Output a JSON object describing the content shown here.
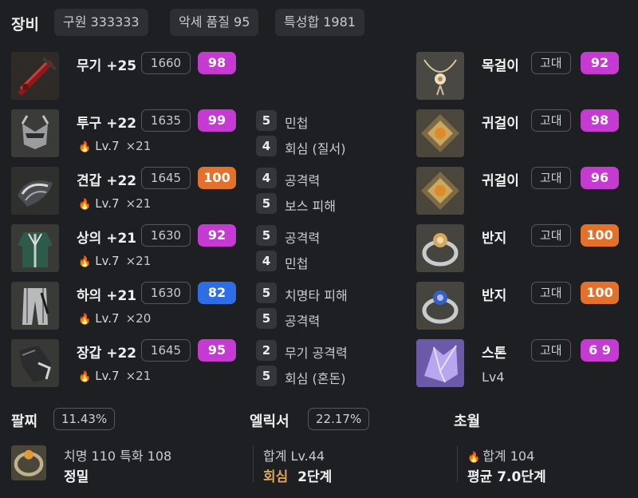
{
  "header": {
    "title": "장비",
    "chips": [
      "구원 333333",
      "악세 품질 95",
      "특성합 1981"
    ]
  },
  "gear": [
    {
      "name": "무기 +25",
      "ilvl": "1660",
      "quality": "98",
      "qcolor": "purple",
      "icon": "weapon-icon",
      "gem": null,
      "stats": []
    },
    {
      "name": "투구 +22",
      "ilvl": "1635",
      "quality": "99",
      "qcolor": "purple",
      "icon": "helmet-icon",
      "gem": {
        "level": "Lv.7",
        "count": "×21"
      },
      "stats": [
        {
          "num": "5",
          "label": "민첩"
        },
        {
          "num": "4",
          "label": "회심 (질서)"
        }
      ]
    },
    {
      "name": "견갑 +22",
      "ilvl": "1645",
      "quality": "100",
      "qcolor": "orange",
      "icon": "shoulder-icon",
      "gem": {
        "level": "Lv.7",
        "count": "×21"
      },
      "stats": [
        {
          "num": "4",
          "label": "공격력"
        },
        {
          "num": "5",
          "label": "보스 피해"
        }
      ]
    },
    {
      "name": "상의 +21",
      "ilvl": "1630",
      "quality": "92",
      "qcolor": "purple",
      "icon": "chest-icon",
      "gem": {
        "level": "Lv.7",
        "count": "×21"
      },
      "stats": [
        {
          "num": "5",
          "label": "공격력"
        },
        {
          "num": "4",
          "label": "민첩"
        }
      ]
    },
    {
      "name": "하의 +21",
      "ilvl": "1630",
      "quality": "82",
      "qcolor": "blue",
      "icon": "pants-icon",
      "gem": {
        "level": "Lv.7",
        "count": "×20"
      },
      "stats": [
        {
          "num": "5",
          "label": "치명타 피해"
        },
        {
          "num": "5",
          "label": "공격력"
        }
      ]
    },
    {
      "name": "장갑 +22",
      "ilvl": "1645",
      "quality": "95",
      "qcolor": "purple",
      "icon": "gloves-icon",
      "gem": {
        "level": "Lv.7",
        "count": "×21"
      },
      "stats": [
        {
          "num": "2",
          "label": "무기 공격력"
        },
        {
          "num": "5",
          "label": "회심 (혼돈)"
        }
      ]
    }
  ],
  "accessories": [
    {
      "name": "목걸이",
      "grade": "고대",
      "quality": "92",
      "qcolor": "purple",
      "icon": "necklace-icon"
    },
    {
      "name": "귀걸이",
      "grade": "고대",
      "quality": "98",
      "qcolor": "purple",
      "icon": "earring-icon"
    },
    {
      "name": "귀걸이",
      "grade": "고대",
      "quality": "96",
      "qcolor": "purple",
      "icon": "earring-icon"
    },
    {
      "name": "반지",
      "grade": "고대",
      "quality": "100",
      "qcolor": "orange",
      "icon": "ring-icon"
    },
    {
      "name": "반지",
      "grade": "고대",
      "quality": "100",
      "qcolor": "orange",
      "icon": "ring-icon"
    },
    {
      "name": "스톤",
      "grade": "고대",
      "quality": "6 9",
      "qcolor": "purple",
      "icon": "stone-icon",
      "sub": "Lv4"
    }
  ],
  "bracelet": {
    "title": "팔찌",
    "percent": "11.43%",
    "line1": "치명 110  특화 108",
    "line2": "정밀"
  },
  "elixir": {
    "title": "엘릭서",
    "percent": "22.17%",
    "line1": "합계 Lv.44",
    "line2_key": "회심",
    "line2_val": "2단계"
  },
  "transcend": {
    "title": "초월",
    "line1": "합계 104",
    "line2": "평균 7.0단계"
  },
  "colors": {
    "bg": "#1e1f22",
    "purple": "#c53ad1",
    "orange": "#e2722b",
    "blue": "#2d6ee6",
    "gold": "#e0a35a"
  }
}
